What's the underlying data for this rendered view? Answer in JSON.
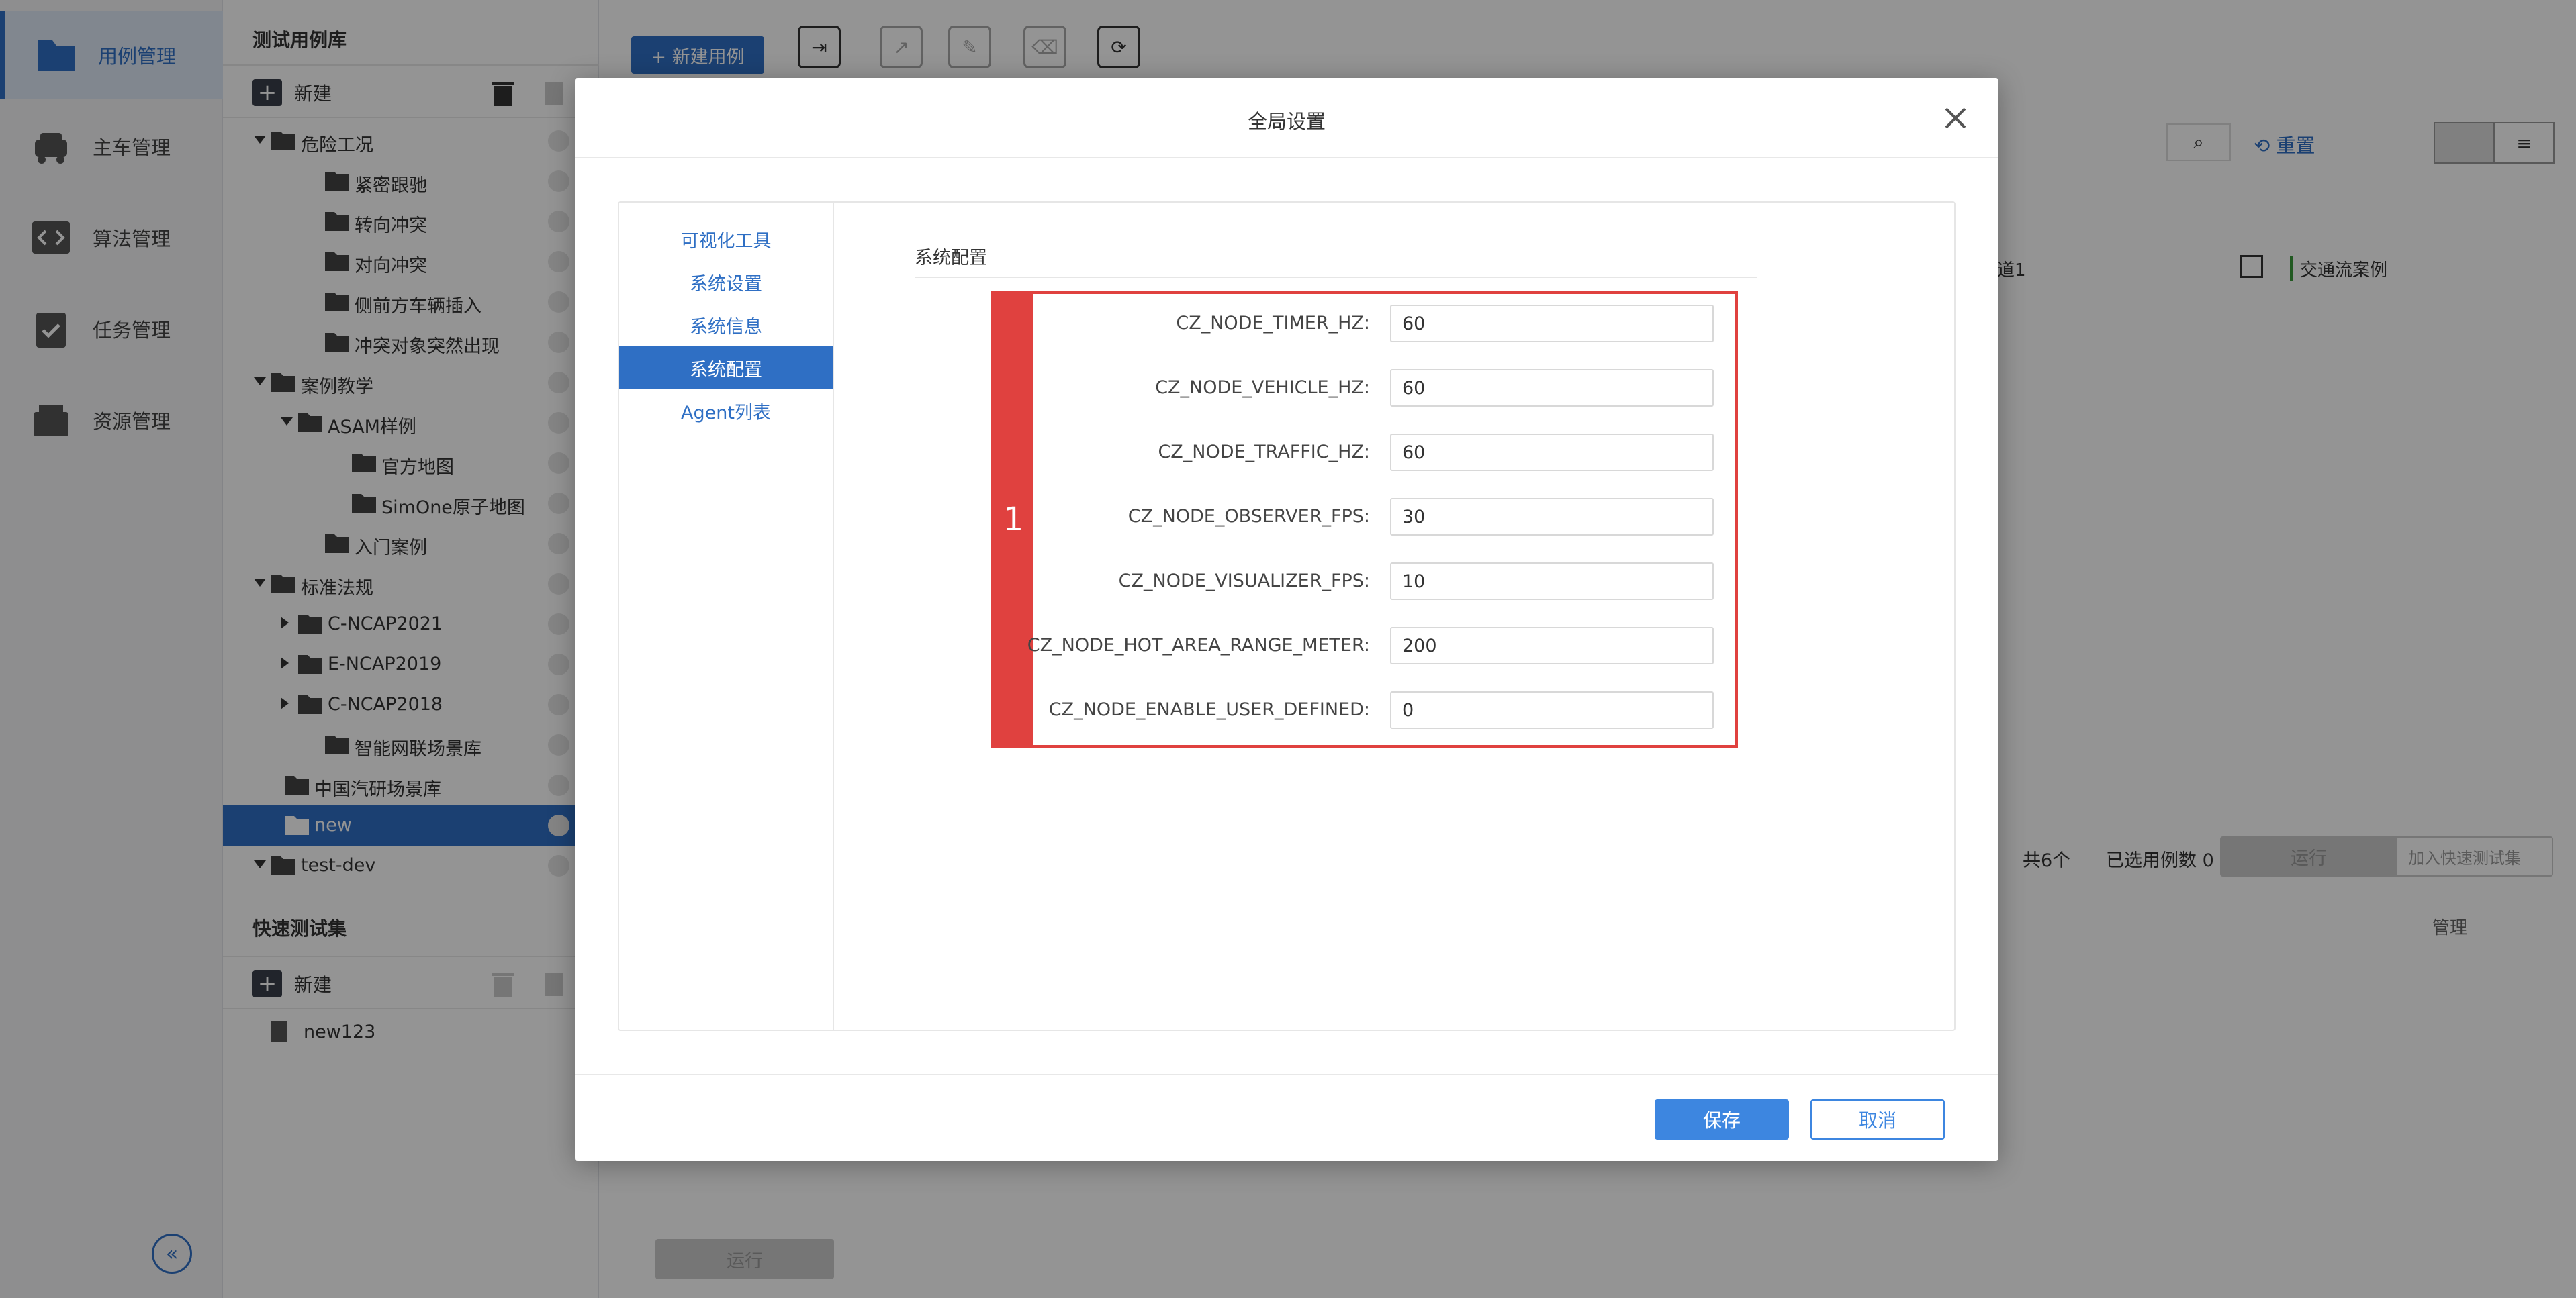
{
  "nav": {
    "items": [
      {
        "label": "用例管理",
        "icon": "folder-icon"
      },
      {
        "label": "主车管理",
        "icon": "car-icon"
      },
      {
        "label": "算法管理",
        "icon": "code-icon"
      },
      {
        "label": "任务管理",
        "icon": "clipboard-check-icon"
      },
      {
        "label": "资源管理",
        "icon": "inbox-icon"
      }
    ],
    "collapse_symbol": "«"
  },
  "tree_panel": {
    "title": "测试用例库",
    "new_label": "新建",
    "rows": [
      {
        "label": "危险工况",
        "expanded": true
      },
      {
        "label": "紧密跟驰"
      },
      {
        "label": "转向冲突"
      },
      {
        "label": "对向冲突"
      },
      {
        "label": "侧前方车辆插入"
      },
      {
        "label": "冲突对象突然出现"
      },
      {
        "label": "案例教学",
        "expanded": true
      },
      {
        "label": "ASAM样例",
        "expanded": true
      },
      {
        "label": "官方地图"
      },
      {
        "label": "SimOne原子地图"
      },
      {
        "label": "入门案例"
      },
      {
        "label": "标准法规",
        "expanded": true
      },
      {
        "label": "C-NCAP2021",
        "expanded": false
      },
      {
        "label": "E-NCAP2019",
        "expanded": false
      },
      {
        "label": "C-NCAP2018",
        "expanded": false
      },
      {
        "label": "智能网联场景库"
      },
      {
        "label": "中国汽研场景库"
      },
      {
        "label": "new",
        "selected": true
      },
      {
        "label": "test-dev",
        "expanded": true
      }
    ],
    "quick_title": "快速测试集",
    "quick_new_label": "新建",
    "quick_items": [
      "new123"
    ]
  },
  "main": {
    "new_case_label": "+ 新建用例",
    "reset_label": "重置",
    "column_fragment": "道1",
    "traffic_flow_label": "交通流案例",
    "total_label": "共6个",
    "selected_label": "已选用例数 0",
    "run_label": "运行",
    "add_quick_label": "加入快速测试集",
    "manage_label": "管理",
    "bottom_run_label": "运行"
  },
  "modal": {
    "title": "全局设置",
    "menu": [
      {
        "label": "可视化工具"
      },
      {
        "label": "系统设置"
      },
      {
        "label": "系统信息"
      },
      {
        "label": "系统配置",
        "active": true
      },
      {
        "label": "Agent列表"
      }
    ],
    "section_title": "系统配置",
    "annotation_number": "1",
    "fields": [
      {
        "label": "CZ_NODE_TIMER_HZ:",
        "value": "60"
      },
      {
        "label": "CZ_NODE_VEHICLE_HZ:",
        "value": "60"
      },
      {
        "label": "CZ_NODE_TRAFFIC_HZ:",
        "value": "60"
      },
      {
        "label": "CZ_NODE_OBSERVER_FPS:",
        "value": "30"
      },
      {
        "label": "CZ_NODE_VISUALIZER_FPS:",
        "value": "10"
      },
      {
        "label": "CZ_NODE_HOT_AREA_RANGE_METER:",
        "value": "200"
      },
      {
        "label": "CZ_NODE_ENABLE_USER_DEFINED:",
        "value": "0"
      }
    ],
    "save_label": "保存",
    "cancel_label": "取消"
  },
  "colors": {
    "accent": "#2f6fc4",
    "button_blue": "#3d86e0",
    "annotation_red": "#e0413f"
  }
}
